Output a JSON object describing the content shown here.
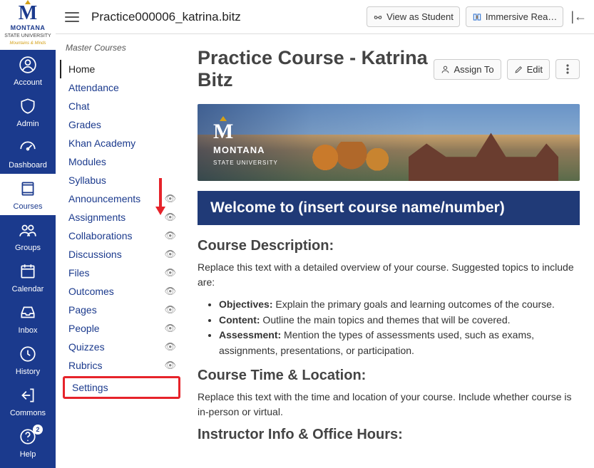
{
  "logo": {
    "initial": "M",
    "line1": "MONTANA",
    "line2": "STATE UNIVERSITY",
    "tagline": "Mountains & Minds"
  },
  "rail": {
    "items": [
      {
        "id": "account",
        "label": "Account"
      },
      {
        "id": "admin",
        "label": "Admin"
      },
      {
        "id": "dashboard",
        "label": "Dashboard"
      },
      {
        "id": "courses",
        "label": "Courses"
      },
      {
        "id": "groups",
        "label": "Groups"
      },
      {
        "id": "calendar",
        "label": "Calendar"
      },
      {
        "id": "inbox",
        "label": "Inbox"
      },
      {
        "id": "history",
        "label": "History"
      },
      {
        "id": "commons",
        "label": "Commons"
      },
      {
        "id": "help",
        "label": "Help",
        "badge": "2"
      }
    ],
    "active": "courses"
  },
  "header": {
    "breadcrumb": "Practice000006_katrina.bitz",
    "view_student": "View as Student",
    "immersive": "Immersive Rea…"
  },
  "course_nav": {
    "crumb": "Master Courses",
    "items": [
      {
        "label": "Home",
        "current": true
      },
      {
        "label": "Attendance"
      },
      {
        "label": "Chat"
      },
      {
        "label": "Grades"
      },
      {
        "label": "Khan Academy"
      },
      {
        "label": "Modules"
      },
      {
        "label": "Syllabus"
      },
      {
        "label": "Announcements",
        "hidden": true
      },
      {
        "label": "Assignments",
        "hidden": true
      },
      {
        "label": "Collaborations",
        "hidden": true
      },
      {
        "label": "Discussions",
        "hidden": true
      },
      {
        "label": "Files",
        "hidden": true
      },
      {
        "label": "Outcomes",
        "hidden": true
      },
      {
        "label": "Pages",
        "hidden": true
      },
      {
        "label": "People",
        "hidden": true
      },
      {
        "label": "Quizzes",
        "hidden": true
      },
      {
        "label": "Rubrics",
        "hidden": true
      },
      {
        "label": "Settings",
        "highlight": true
      }
    ]
  },
  "page": {
    "title": "Practice Course - Katrina Bitz",
    "assign": "Assign To",
    "edit": "Edit",
    "banner_logo_line1": "MONTANA",
    "banner_logo_line2": "STATE UNIVERSITY",
    "welcome": "Welcome to (insert course name/number)",
    "desc_h": "Course Description:",
    "desc_p": "Replace this text with a detailed overview of your course. Suggested topics to include are:",
    "bullets": {
      "obj_l": "Objectives:",
      "obj_t": " Explain the primary goals and learning outcomes of the course.",
      "con_l": "Content:",
      "con_t": " Outline the main topics and themes that will be covered.",
      "ass_l": "Assessment:",
      "ass_t": " Mention the types of assessments used, such as exams, assignments, presentations, or participation."
    },
    "time_h": "Course Time & Location:",
    "time_p": "Replace this text with the time and location of your course. Include whether course is in-person or virtual.",
    "instr_h": "Instructor Info & Office Hours:"
  }
}
